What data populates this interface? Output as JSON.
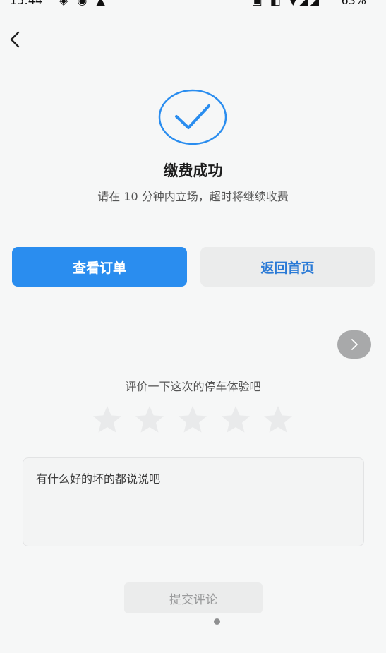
{
  "status_bar": {
    "time": "15:44",
    "left_icons": "◈ ◉ ▲",
    "right_icons": "▣ ◧ ▼◢◢",
    "battery": "63%"
  },
  "header": {
    "back_icon": "chevron-left-icon"
  },
  "result": {
    "icon": "check-circle-icon",
    "accent_color": "#2a8def",
    "title": "缴费成功",
    "subtitle": "请在 10 分钟内立场，超时将继续收费"
  },
  "actions": {
    "view_order_label": "查看订单",
    "back_home_label": "返回首页"
  },
  "review": {
    "next_icon": "chevron-right-icon",
    "prompt": "评价一下这次的停车体验吧",
    "rating_max": 5,
    "rating_value": 0,
    "comment_placeholder": "有什么好的坏的都说说吧",
    "submit_label": "提交评论"
  }
}
